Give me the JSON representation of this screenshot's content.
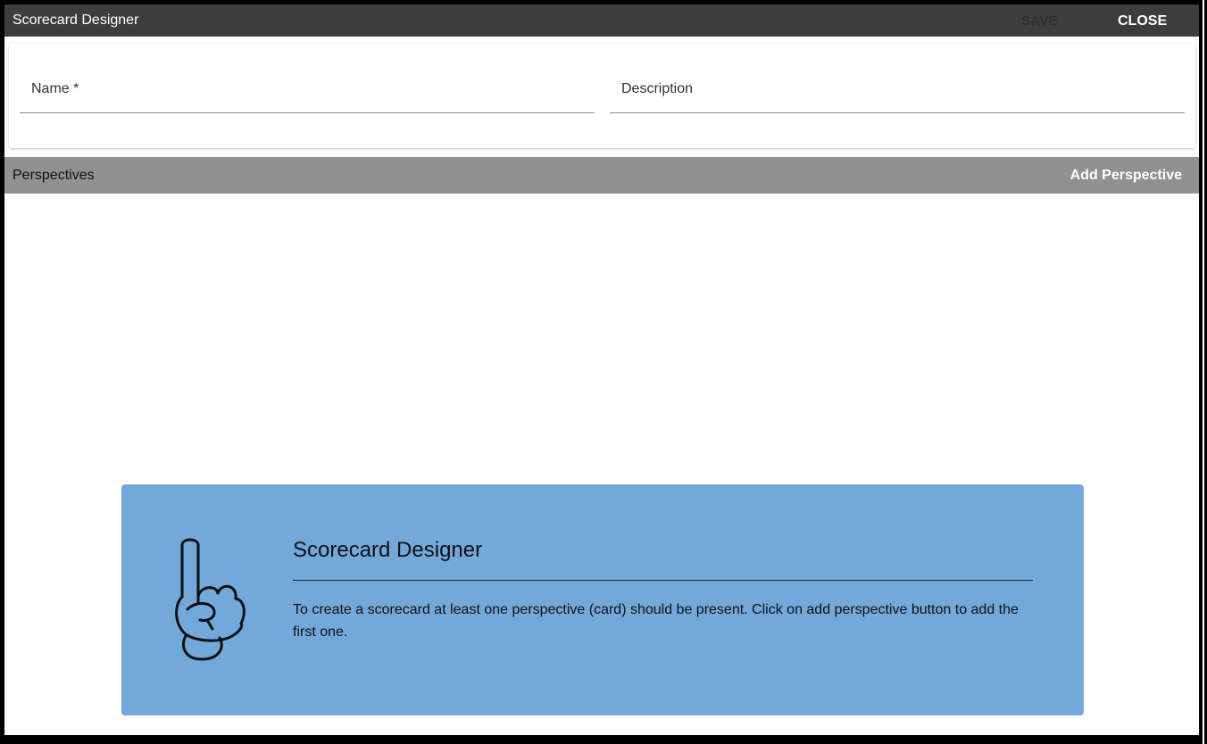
{
  "window": {
    "title": "Scorecard Designer",
    "save_label": "SAVE",
    "close_label": "CLOSE"
  },
  "form": {
    "name_label": "Name *",
    "description_label": "Description"
  },
  "perspectives": {
    "header_label": "Perspectives",
    "add_label": "Add Perspective"
  },
  "info": {
    "icon": "pointing-hand-icon",
    "heading": "Scorecard Designer",
    "message": "To create a scorecard at least one perspective (card) should be present. Click on add perspective button to add the first one."
  },
  "colors": {
    "titlebar": "#3d3d3d",
    "perspectives_bar": "#919191",
    "info_box": "#73a8da"
  }
}
